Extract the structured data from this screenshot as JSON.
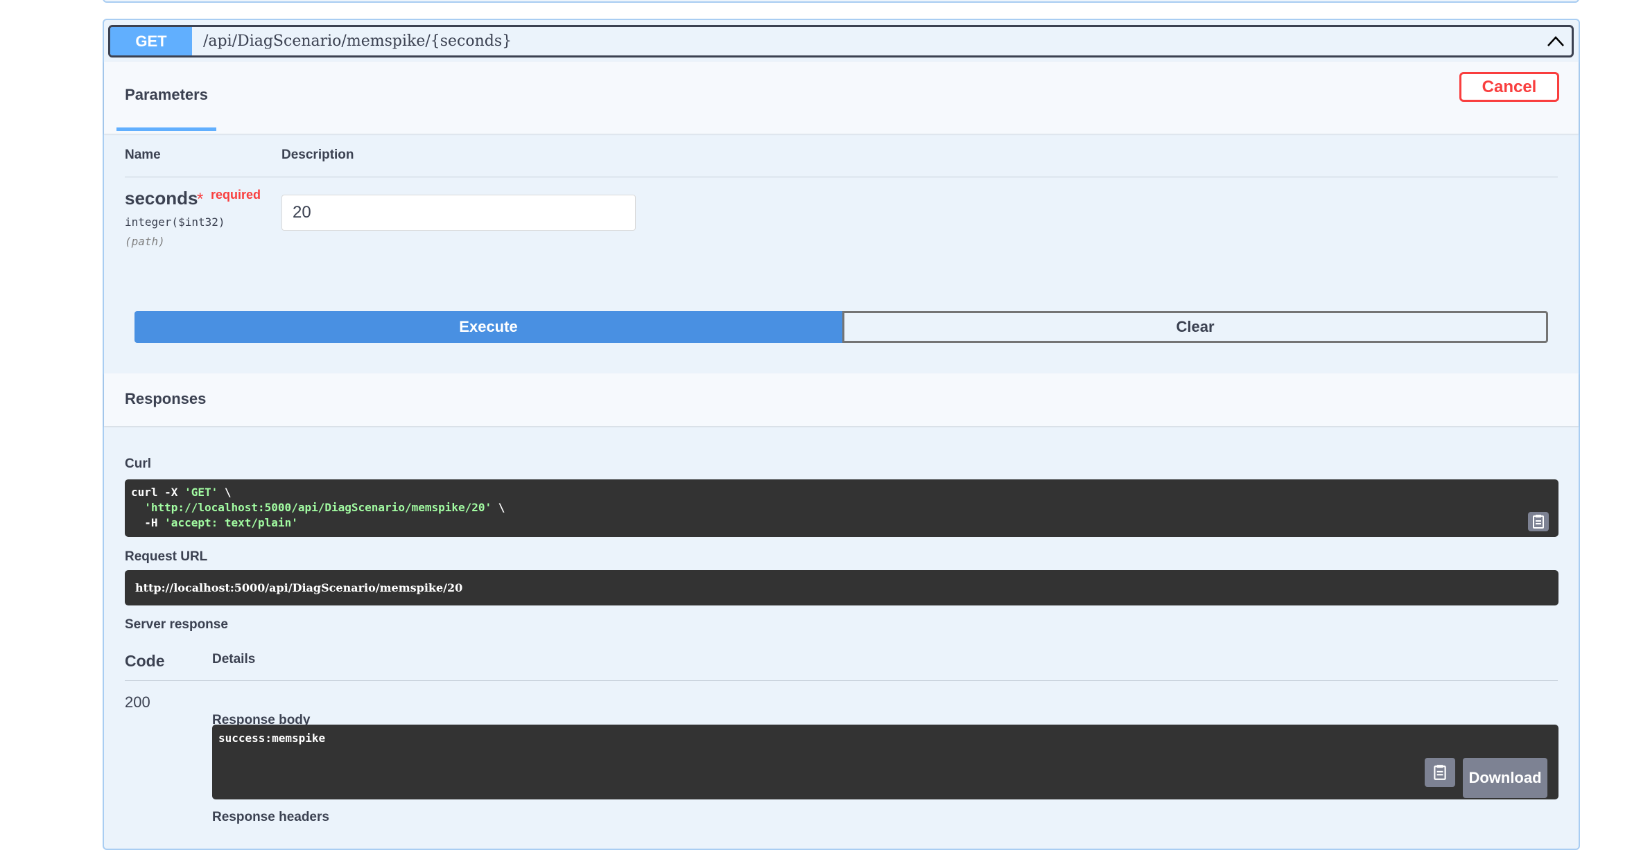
{
  "operation": {
    "method": "GET",
    "path": "/api/DiagScenario/memspike/{seconds}"
  },
  "parameters_tab": "Parameters",
  "cancel_label": "Cancel",
  "table_headers": {
    "name": "Name",
    "description": "Description"
  },
  "param": {
    "name": "seconds",
    "required_star": "*",
    "required_label": "required",
    "type": "integer($int32)",
    "in": "(path)",
    "value": "20"
  },
  "buttons": {
    "execute": "Execute",
    "clear": "Clear"
  },
  "responses_title": "Responses",
  "curl": {
    "label": "Curl",
    "line1_cmd": "curl -X ",
    "line1_str": "'GET'",
    "line1_end": " \\",
    "line2_str": "'http://localhost:5000/api/DiagScenario/memspike/20'",
    "line2_end": " \\",
    "line3_cmd": "  -H ",
    "line3_str": "'accept: text/plain'"
  },
  "request_url": {
    "label": "Request URL",
    "value": "http://localhost:5000/api/DiagScenario/memspike/20"
  },
  "server_response": {
    "label": "Server response",
    "code_header": "Code",
    "details_header": "Details",
    "code": "200",
    "body_label": "Response body",
    "body": "success:memspike",
    "download_label": "Download",
    "headers_label": "Response headers"
  },
  "colors": {
    "get": "#61affe",
    "execute": "#4990e2",
    "cancel": "#f93e3e",
    "code_bg": "#333333"
  }
}
